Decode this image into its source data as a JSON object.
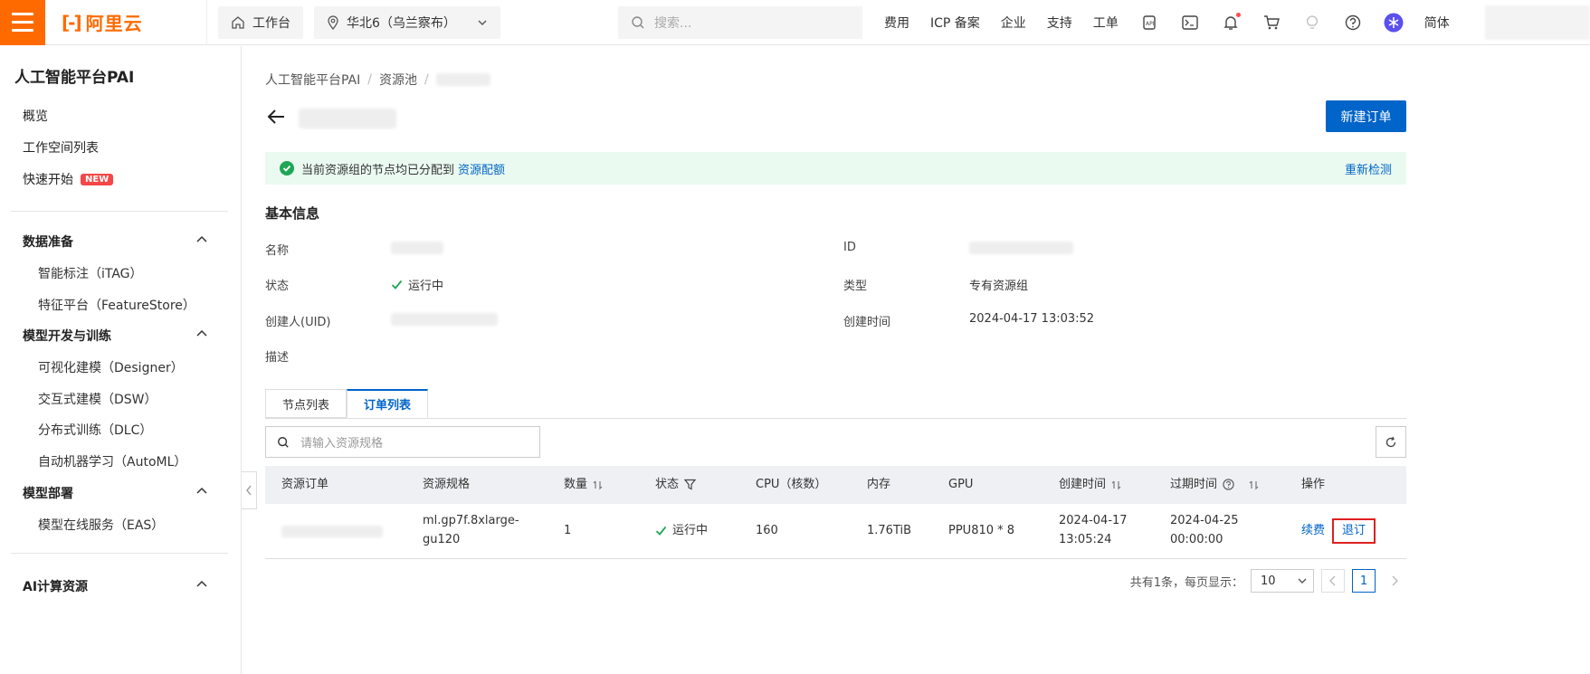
{
  "topbar": {
    "logo_text": "阿里云",
    "workbench": "工作台",
    "region": "华北6（乌兰察布）",
    "search_placeholder": "搜索...",
    "links": [
      "费用",
      "ICP 备案",
      "企业",
      "支持",
      "工单"
    ],
    "lang": "简体"
  },
  "sidebar": {
    "title": "人工智能平台PAI",
    "top_items": [
      "概览",
      "工作空间列表",
      "快速开始"
    ],
    "new_badge": "NEW",
    "groups": {
      "data_prep": "数据准备",
      "data_prep_items": [
        "智能标注（iTAG）",
        "特征平台（FeatureStore）"
      ],
      "model_dev": "模型开发与训练",
      "model_dev_items": [
        "可视化建模（Designer）",
        "交互式建模（DSW）",
        "分布式训练（DLC）",
        "自动机器学习（AutoML）"
      ],
      "deploy": "模型部署",
      "deploy_items": [
        "模型在线服务（EAS）"
      ],
      "compute": "AI计算资源"
    }
  },
  "main": {
    "breadcrumb": [
      "人工智能平台PAI",
      "资源池"
    ],
    "new_order_btn": "新建订单",
    "alert": {
      "text": "当前资源组的节点均已分配到",
      "link": "资源配额",
      "action": "重新检测"
    },
    "basic_info_title": "基本信息",
    "info": {
      "name_label": "名称",
      "id_label": "ID",
      "status_label": "状态",
      "status_value": "运行中",
      "type_label": "类型",
      "type_value": "专有资源组",
      "creator_label": "创建人(UID)",
      "created_label": "创建时间",
      "created_value": "2024-04-17 13:03:52",
      "desc_label": "描述"
    },
    "tabs": [
      "节点列表",
      "订单列表"
    ],
    "table_search_placeholder": "请输入资源规格",
    "table": {
      "headers": [
        "资源订单",
        "资源规格",
        "数量",
        "状态",
        "CPU（核数）",
        "内存",
        "GPU",
        "创建时间",
        "过期时间",
        "操作"
      ],
      "row": {
        "spec_line1": "ml.gp7f.8xlarge-",
        "spec_line2": "gu120",
        "qty": "1",
        "status": "运行中",
        "cpu": "160",
        "mem": "1.76TiB",
        "gpu": "PPU810 * 8",
        "created_line1": "2024-04-17",
        "created_line2": "13:05:24",
        "expire_line1": "2024-04-25",
        "expire_line2": "00:00:00",
        "renew": "续费",
        "unsubscribe": "退订"
      }
    },
    "pager": {
      "summary": "共有1条，每页显示：",
      "page_size": "10",
      "current_page": "1"
    }
  }
}
